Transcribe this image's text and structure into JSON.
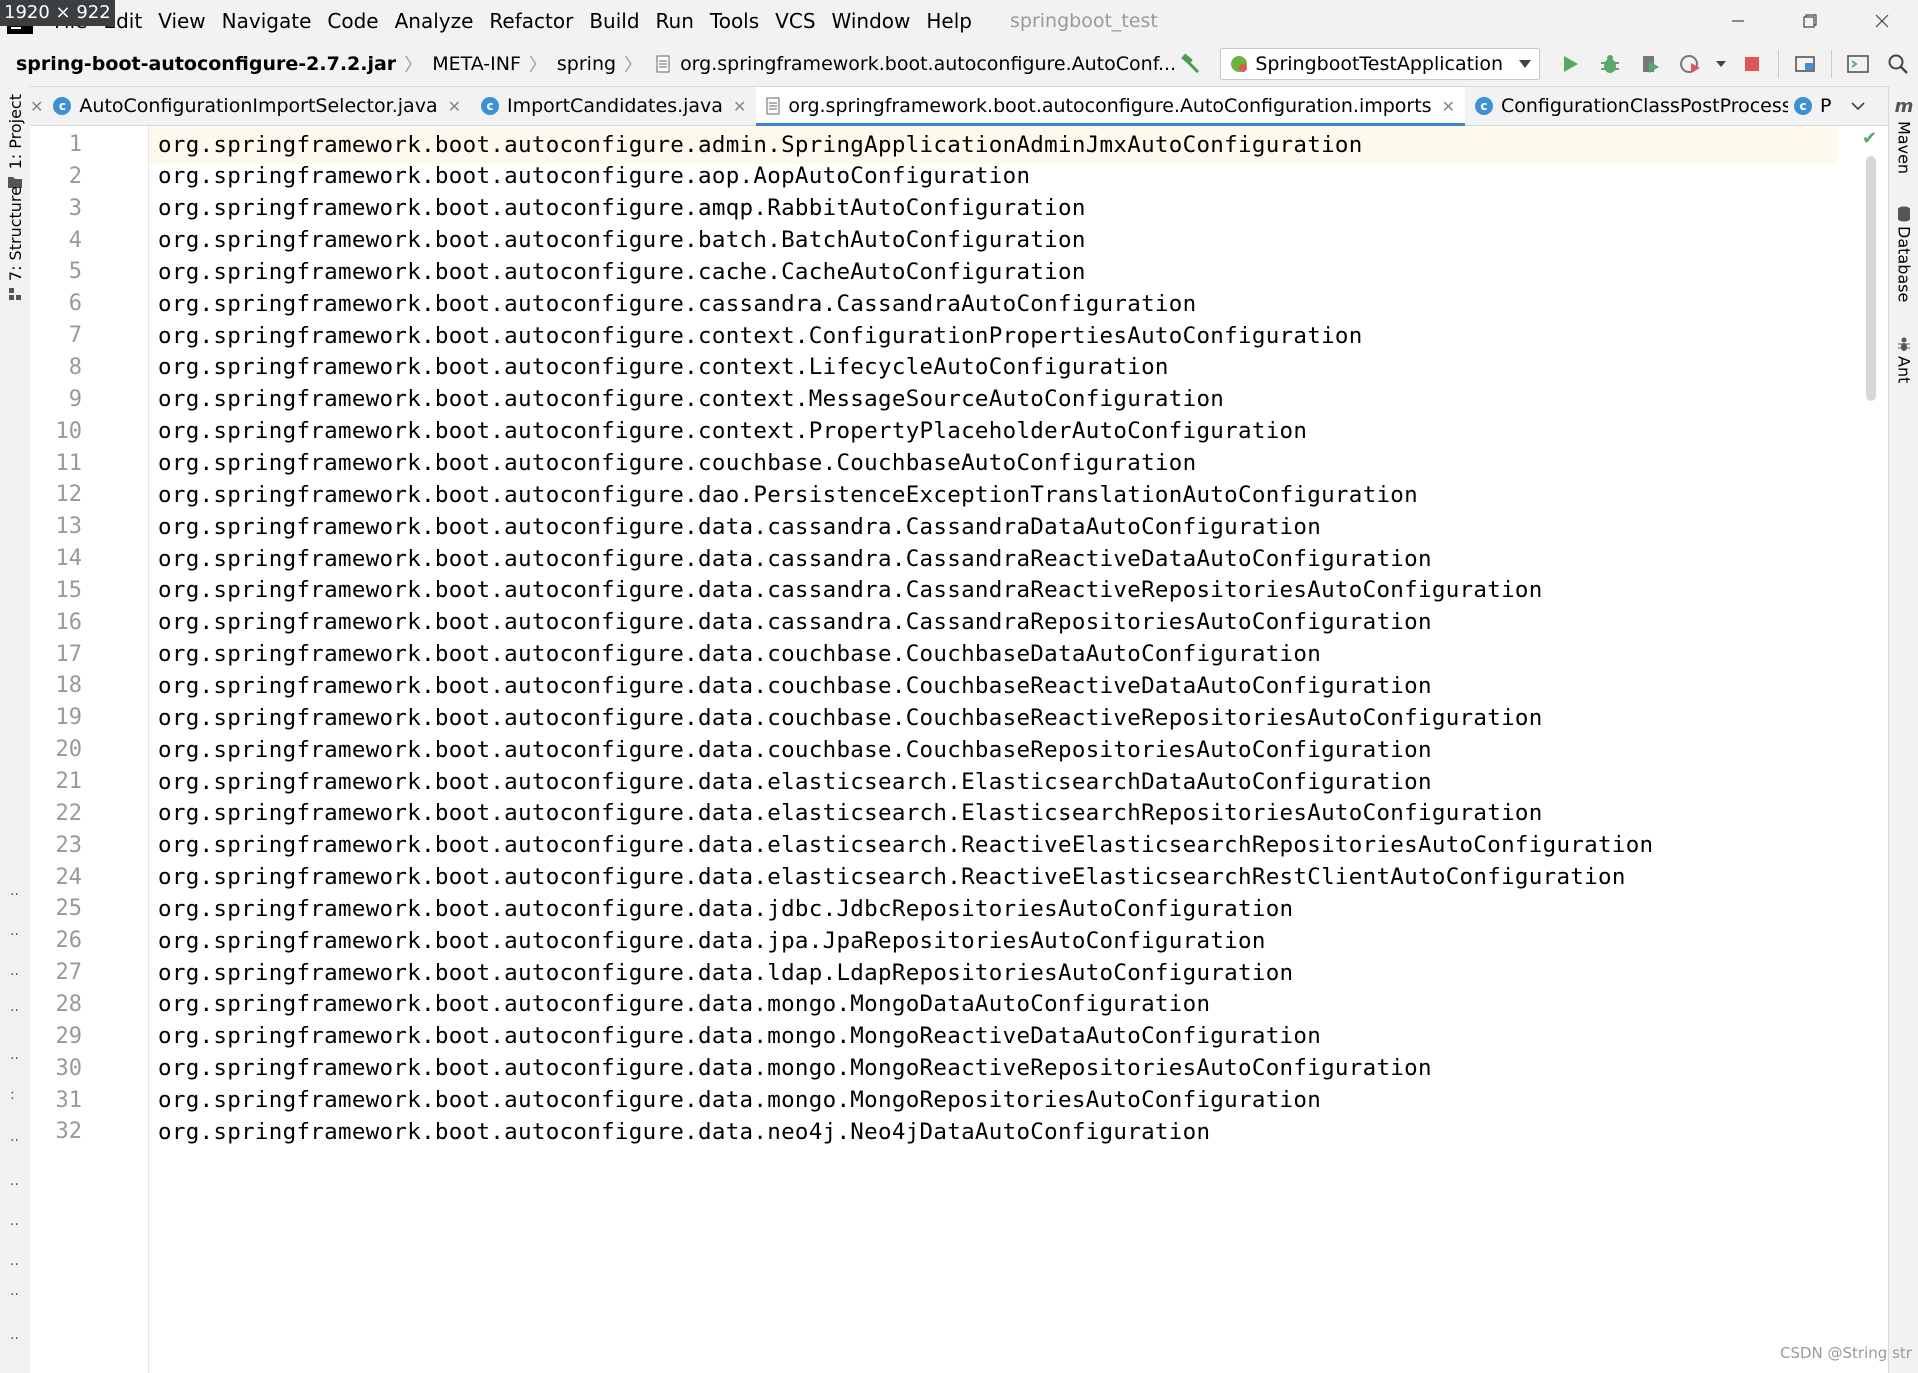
{
  "overlay": {
    "size_badge": "1920 × 922"
  },
  "menubar": {
    "items": [
      "File",
      "Edit",
      "View",
      "Navigate",
      "Code",
      "Analyze",
      "Refactor",
      "Build",
      "Run",
      "Tools",
      "VCS",
      "Window",
      "Help"
    ],
    "project_title": "springboot_test"
  },
  "breadcrumb": {
    "items": [
      "spring-boot-autoconfigure-2.7.2.jar",
      "META-INF",
      "spring",
      "org.springframework.boot.autoconfigure.AutoConf..."
    ]
  },
  "toolbar": {
    "run_config": "SpringbootTestApplication"
  },
  "left_strip": {
    "project_tab": "1: Project",
    "structure_tab": "7: Structure"
  },
  "right_strip": {
    "maven_tab": "Maven",
    "database_tab": "Database",
    "ant_tab": "Ant"
  },
  "tabs": [
    {
      "label": "AutoConfigurationImportSelector.java",
      "icon": "java-class-icon",
      "active": false
    },
    {
      "label": "ImportCandidates.java",
      "icon": "java-class-icon",
      "active": false
    },
    {
      "label": "org.springframework.boot.autoconfigure.AutoConfiguration.imports",
      "icon": "text-file-icon",
      "active": true
    },
    {
      "label": "ConfigurationClassPostProcessor.java",
      "icon": "java-class-icon",
      "active": false
    }
  ],
  "tab_overflow_label": "P",
  "editor": {
    "lines": [
      {
        "n": "1",
        "text": "org.springframework.boot.autoconfigure.admin.SpringApplicationAdminJmxAutoConfiguration"
      },
      {
        "n": "2",
        "text": "org.springframework.boot.autoconfigure.aop.AopAutoConfiguration"
      },
      {
        "n": "3",
        "text": "org.springframework.boot.autoconfigure.amqp.RabbitAutoConfiguration"
      },
      {
        "n": "4",
        "text": "org.springframework.boot.autoconfigure.batch.BatchAutoConfiguration"
      },
      {
        "n": "5",
        "text": "org.springframework.boot.autoconfigure.cache.CacheAutoConfiguration"
      },
      {
        "n": "6",
        "text": "org.springframework.boot.autoconfigure.cassandra.CassandraAutoConfiguration"
      },
      {
        "n": "7",
        "text": "org.springframework.boot.autoconfigure.context.ConfigurationPropertiesAutoConfiguration"
      },
      {
        "n": "8",
        "text": "org.springframework.boot.autoconfigure.context.LifecycleAutoConfiguration"
      },
      {
        "n": "9",
        "text": "org.springframework.boot.autoconfigure.context.MessageSourceAutoConfiguration"
      },
      {
        "n": "10",
        "text": "org.springframework.boot.autoconfigure.context.PropertyPlaceholderAutoConfiguration"
      },
      {
        "n": "11",
        "text": "org.springframework.boot.autoconfigure.couchbase.CouchbaseAutoConfiguration"
      },
      {
        "n": "12",
        "text": "org.springframework.boot.autoconfigure.dao.PersistenceExceptionTranslationAutoConfiguration"
      },
      {
        "n": "13",
        "text": "org.springframework.boot.autoconfigure.data.cassandra.CassandraDataAutoConfiguration"
      },
      {
        "n": "14",
        "text": "org.springframework.boot.autoconfigure.data.cassandra.CassandraReactiveDataAutoConfiguration"
      },
      {
        "n": "15",
        "text": "org.springframework.boot.autoconfigure.data.cassandra.CassandraReactiveRepositoriesAutoConfiguration"
      },
      {
        "n": "16",
        "text": "org.springframework.boot.autoconfigure.data.cassandra.CassandraRepositoriesAutoConfiguration"
      },
      {
        "n": "17",
        "text": "org.springframework.boot.autoconfigure.data.couchbase.CouchbaseDataAutoConfiguration"
      },
      {
        "n": "18",
        "text": "org.springframework.boot.autoconfigure.data.couchbase.CouchbaseReactiveDataAutoConfiguration"
      },
      {
        "n": "19",
        "text": "org.springframework.boot.autoconfigure.data.couchbase.CouchbaseReactiveRepositoriesAutoConfiguration"
      },
      {
        "n": "20",
        "text": "org.springframework.boot.autoconfigure.data.couchbase.CouchbaseRepositoriesAutoConfiguration"
      },
      {
        "n": "21",
        "text": "org.springframework.boot.autoconfigure.data.elasticsearch.ElasticsearchDataAutoConfiguration"
      },
      {
        "n": "22",
        "text": "org.springframework.boot.autoconfigure.data.elasticsearch.ElasticsearchRepositoriesAutoConfiguration"
      },
      {
        "n": "23",
        "text": "org.springframework.boot.autoconfigure.data.elasticsearch.ReactiveElasticsearchRepositoriesAutoConfiguration"
      },
      {
        "n": "24",
        "text": "org.springframework.boot.autoconfigure.data.elasticsearch.ReactiveElasticsearchRestClientAutoConfiguration"
      },
      {
        "n": "25",
        "text": "org.springframework.boot.autoconfigure.data.jdbc.JdbcRepositoriesAutoConfiguration"
      },
      {
        "n": "26",
        "text": "org.springframework.boot.autoconfigure.data.jpa.JpaRepositoriesAutoConfiguration"
      },
      {
        "n": "27",
        "text": "org.springframework.boot.autoconfigure.data.ldap.LdapRepositoriesAutoConfiguration"
      },
      {
        "n": "28",
        "text": "org.springframework.boot.autoconfigure.data.mongo.MongoDataAutoConfiguration"
      },
      {
        "n": "29",
        "text": "org.springframework.boot.autoconfigure.data.mongo.MongoReactiveDataAutoConfiguration"
      },
      {
        "n": "30",
        "text": "org.springframework.boot.autoconfigure.data.mongo.MongoReactiveRepositoriesAutoConfiguration"
      },
      {
        "n": "31",
        "text": "org.springframework.boot.autoconfigure.data.mongo.MongoRepositoriesAutoConfiguration"
      },
      {
        "n": "32",
        "text": "org.springframework.boot.autoconfigure.data.neo4j.Neo4jDataAutoConfiguration"
      }
    ]
  },
  "watermark": "CSDN @String str",
  "colors": {
    "accent": "#4083c9",
    "current_line": "#fcfaed",
    "run_green": "#59a869",
    "stop_red": "#e05555"
  }
}
